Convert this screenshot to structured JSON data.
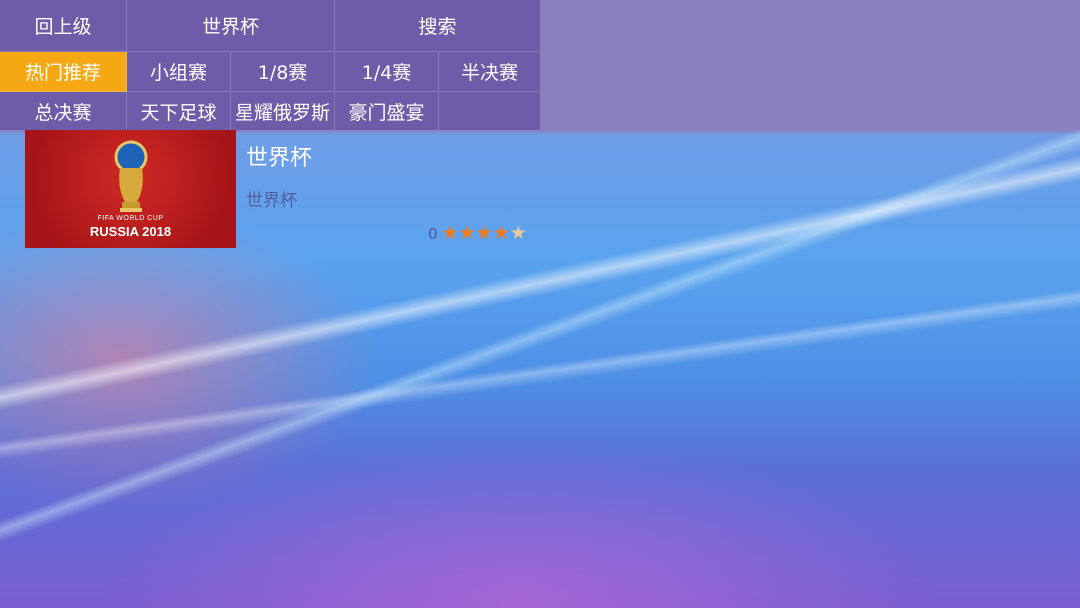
{
  "nav": {
    "row1": [
      {
        "label": "回上级"
      },
      {
        "label": "世界杯"
      },
      {
        "label": "搜索"
      }
    ],
    "row2": [
      {
        "label": "热门推荐",
        "active": true
      },
      {
        "label": "小组赛"
      },
      {
        "label": "1/8赛"
      },
      {
        "label": "1/4赛"
      },
      {
        "label": "半决赛"
      }
    ],
    "row3": [
      {
        "label": "总决赛"
      },
      {
        "label": "天下足球"
      },
      {
        "label": "星耀俄罗斯"
      },
      {
        "label": "豪门盛宴"
      },
      {
        "label": ""
      }
    ]
  },
  "item": {
    "poster": {
      "line1": "FIFA WORLD CUP",
      "line2": "RUSSIA 2018"
    },
    "title": "世界杯",
    "subtitle": "世界杯",
    "score": "0",
    "stars": 4,
    "max_stars": 5
  },
  "colors": {
    "menu_bg": "#6e5ca9",
    "active_bg": "#f5a813",
    "star_on": "#f07c1d",
    "star_off": "#e6c9a0"
  }
}
